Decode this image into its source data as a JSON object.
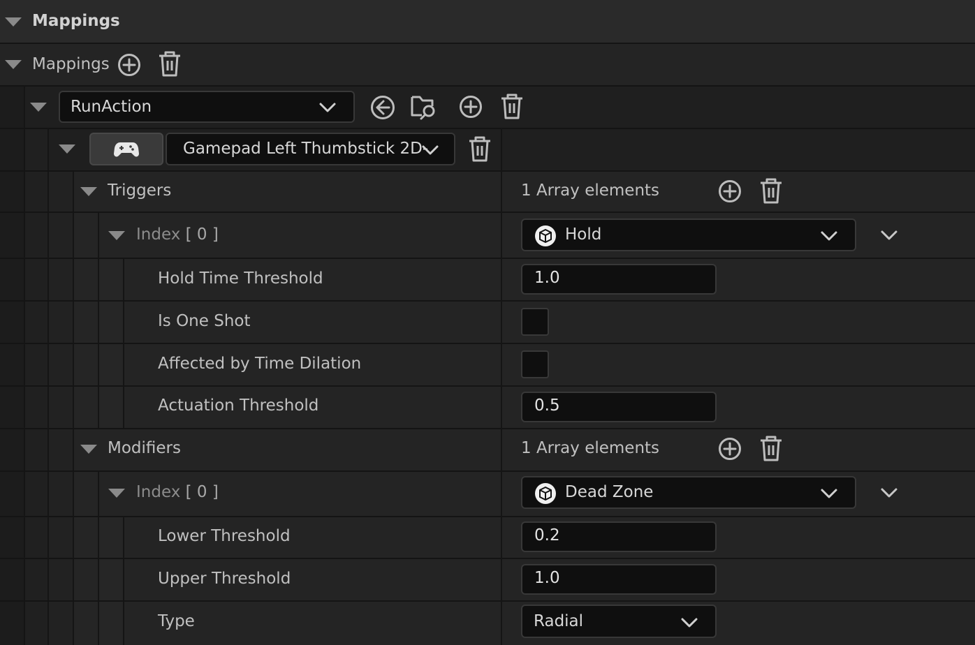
{
  "section": {
    "title": "Mappings"
  },
  "mappings": {
    "label": "Mappings",
    "add_icon": "plus-circle-icon",
    "delete_icon": "trash-icon"
  },
  "action": {
    "value": "RunAction",
    "icons": [
      "back-arrow-circle-icon",
      "folder-search-icon",
      "plus-circle-icon",
      "trash-icon"
    ]
  },
  "key_binding": {
    "device_icon": "gamepad-icon",
    "value": "Gamepad Left Thumbstick 2D-",
    "delete_icon": "trash-icon"
  },
  "triggers": {
    "label": "Triggers",
    "count_text": "1 Array elements",
    "index_label": "Index",
    "index_value": "[ 0 ]",
    "class_value": "Hold",
    "properties": {
      "hold_time_threshold": {
        "label": "Hold Time Threshold",
        "value": "1.0"
      },
      "is_one_shot": {
        "label": "Is One Shot",
        "checked": false
      },
      "affected_by_time_dilation": {
        "label": "Affected by Time Dilation",
        "checked": false
      },
      "actuation_threshold": {
        "label": "Actuation Threshold",
        "value": "0.5"
      }
    }
  },
  "modifiers": {
    "label": "Modifiers",
    "count_text": "1 Array elements",
    "index_label": "Index",
    "index_value": "[ 0 ]",
    "class_value": "Dead Zone",
    "properties": {
      "lower_threshold": {
        "label": "Lower Threshold",
        "value": "0.2"
      },
      "upper_threshold": {
        "label": "Upper Threshold",
        "value": "1.0"
      },
      "type": {
        "label": "Type",
        "value": "Radial"
      }
    }
  },
  "colors": {
    "background": "#242424",
    "field_bg": "#0f0f0f",
    "text": "#c0c0c0",
    "dim_text": "#8c8c8c"
  }
}
